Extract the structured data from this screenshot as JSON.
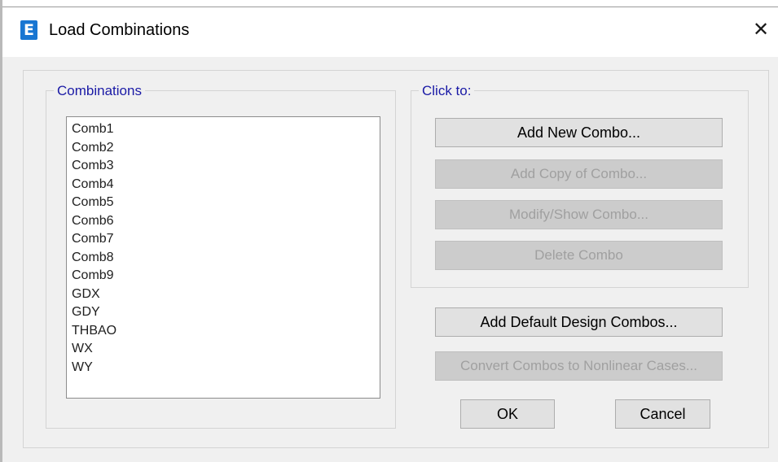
{
  "window": {
    "title": "Load Combinations",
    "app_icon_letter": "E",
    "close_glyph": "✕"
  },
  "combinations_group": {
    "label": "Combinations",
    "items": [
      "Comb1",
      "Comb2",
      "Comb3",
      "Comb4",
      "Comb5",
      "Comb6",
      "Comb7",
      "Comb8",
      "Comb9",
      "GDX",
      "GDY",
      "THBAO",
      "WX",
      "WY"
    ]
  },
  "click_to_group": {
    "label": "Click to:",
    "add_new_combo": "Add New Combo...",
    "add_copy_of_combo": "Add Copy of Combo...",
    "modify_show_combo": "Modify/Show Combo...",
    "delete_combo": "Delete Combo"
  },
  "extra_actions": {
    "add_default_design_combos": "Add Default Design Combos...",
    "convert_combos": "Convert Combos to Nonlinear Cases..."
  },
  "footer": {
    "ok": "OK",
    "cancel": "Cancel"
  },
  "colors": {
    "group_label": "#1a1aa6",
    "app_icon_bg": "#1976d2",
    "dialog_bg": "#f0f0f0"
  }
}
